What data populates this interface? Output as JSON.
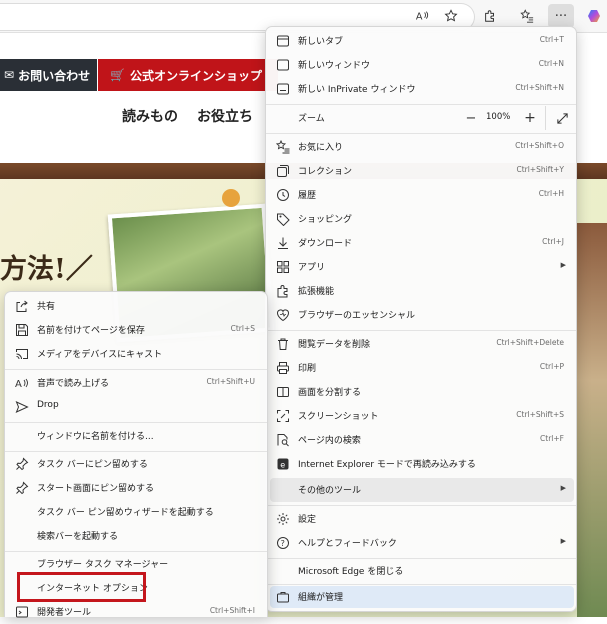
{
  "toolbar": {
    "read_aloud_icon": "read-aloud-icon",
    "favorite_icon": "star-icon",
    "extensions_icon": "puzzle-icon",
    "favorites_icon": "favorites-list-icon",
    "more_label": "···",
    "copilot_icon": "copilot-icon"
  },
  "site": {
    "contact_label": "お問い合わせ",
    "shop_label": "公式オンラインショップ",
    "nav": [
      "読みもの",
      "お役立ち"
    ],
    "hero_title": "方法!／",
    "colors": {
      "shop": "#c01419",
      "contact": "#2a2f36"
    }
  },
  "main_menu": {
    "items": [
      {
        "label": "新しいタブ",
        "shortcut": "Ctrl+T",
        "icon": "new-tab-icon"
      },
      {
        "label": "新しいウィンドウ",
        "shortcut": "Ctrl+N",
        "icon": "new-window-icon"
      },
      {
        "label": "新しい InPrivate ウィンドウ",
        "shortcut": "Ctrl+Shift+N",
        "icon": "inprivate-icon"
      },
      {
        "label": "お気に入り",
        "shortcut": "Ctrl+Shift+O",
        "icon": "favorites-icon"
      },
      {
        "label": "コレクション",
        "shortcut": "Ctrl+Shift+Y",
        "icon": "collections-icon"
      },
      {
        "label": "履歴",
        "shortcut": "Ctrl+H",
        "icon": "history-icon"
      },
      {
        "label": "ショッピング",
        "shortcut": "",
        "icon": "shopping-tag-icon"
      },
      {
        "label": "ダウンロード",
        "shortcut": "Ctrl+J",
        "icon": "download-icon"
      },
      {
        "label": "アプリ",
        "shortcut": "",
        "icon": "apps-icon"
      },
      {
        "label": "拡張機能",
        "shortcut": "",
        "icon": "extensions-icon"
      },
      {
        "label": "ブラウザーのエッセンシャル",
        "shortcut": "",
        "icon": "essentials-icon"
      },
      {
        "label": "閲覧データを削除",
        "shortcut": "Ctrl+Shift+Delete",
        "icon": "trash-icon"
      },
      {
        "label": "印刷",
        "shortcut": "Ctrl+P",
        "icon": "print-icon"
      },
      {
        "label": "画面を分割する",
        "shortcut": "",
        "icon": "split-screen-icon"
      },
      {
        "label": "スクリーンショット",
        "shortcut": "Ctrl+Shift+S",
        "icon": "screenshot-icon"
      },
      {
        "label": "ページ内の検索",
        "shortcut": "Ctrl+F",
        "icon": "find-icon"
      },
      {
        "label": "Internet Explorer モードで再読み込みする",
        "shortcut": "",
        "icon": "ie-mode-icon"
      },
      {
        "label": "その他のツール",
        "shortcut": "",
        "icon": ""
      },
      {
        "label": "設定",
        "shortcut": "",
        "icon": "gear-icon"
      },
      {
        "label": "ヘルプとフィードバック",
        "shortcut": "",
        "icon": "help-icon"
      },
      {
        "label": "Microsoft Edge を閉じる",
        "shortcut": "",
        "icon": ""
      },
      {
        "label": "組織が管理",
        "shortcut": "",
        "icon": "briefcase-icon"
      }
    ],
    "zoom": {
      "label": "ズーム",
      "minus": "−",
      "value": "100%",
      "plus": "+"
    }
  },
  "sub_menu": {
    "items": [
      {
        "label": "共有",
        "shortcut": "",
        "icon": "share-icon"
      },
      {
        "label": "名前を付けてページを保存",
        "shortcut": "Ctrl+S",
        "icon": "save-icon"
      },
      {
        "label": "メディアをデバイスにキャスト",
        "shortcut": "",
        "icon": "cast-icon"
      },
      {
        "label": "音声で読み上げる",
        "shortcut": "Ctrl+Shift+U",
        "icon": "read-aloud-icon"
      },
      {
        "label": "Drop",
        "shortcut": "",
        "icon": "send-icon"
      },
      {
        "label": "ウィンドウに名前を付ける...",
        "shortcut": "",
        "icon": ""
      },
      {
        "label": "タスク バーにピン留めする",
        "shortcut": "",
        "icon": "pin-icon"
      },
      {
        "label": "スタート画面にピン留めする",
        "shortcut": "",
        "icon": "pin-icon"
      },
      {
        "label": "タスク バー ピン留めウィザードを起動する",
        "shortcut": "",
        "icon": ""
      },
      {
        "label": "検索バーを起動する",
        "shortcut": "",
        "icon": ""
      },
      {
        "label": "ブラウザー タスク マネージャー",
        "shortcut": "",
        "icon": ""
      },
      {
        "label": "インターネット オプション",
        "shortcut": "",
        "icon": ""
      },
      {
        "label": "開発者ツール",
        "shortcut": "Ctrl+Shift+I",
        "icon": "devtools-icon"
      }
    ]
  }
}
